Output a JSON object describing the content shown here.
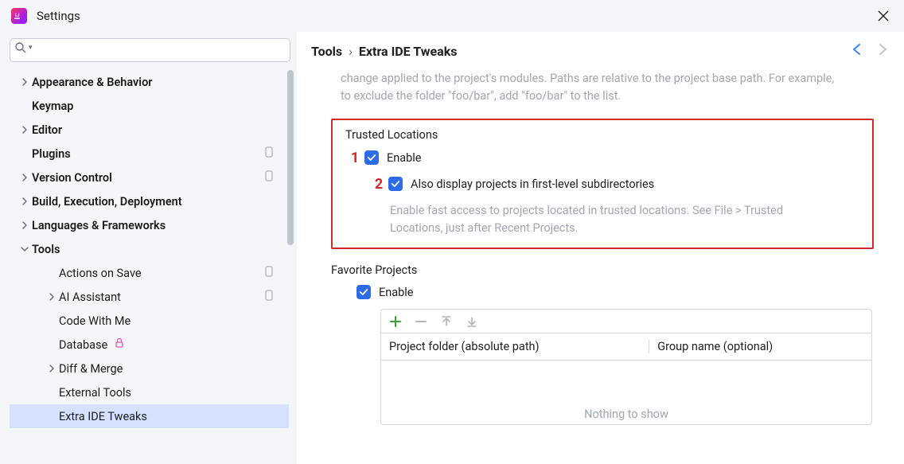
{
  "window": {
    "title": "Settings"
  },
  "breadcrumb": {
    "root": "Tools",
    "leaf": "Extra IDE Tweaks"
  },
  "nav": {
    "back_enabled": true,
    "forward_enabled": false
  },
  "search": {
    "value": ""
  },
  "sidebar": {
    "items": [
      {
        "label": "Appearance & Behavior",
        "level": 0,
        "chev": "right",
        "bold": true
      },
      {
        "label": "Keymap",
        "level": 0,
        "chev": "",
        "bold": true
      },
      {
        "label": "Editor",
        "level": 0,
        "chev": "right",
        "bold": true
      },
      {
        "label": "Plugins",
        "level": 0,
        "chev": "",
        "bold": true,
        "badge": "dot"
      },
      {
        "label": "Version Control",
        "level": 0,
        "chev": "right",
        "bold": true,
        "badge": "dot"
      },
      {
        "label": "Build, Execution, Deployment",
        "level": 0,
        "chev": "right",
        "bold": true
      },
      {
        "label": "Languages & Frameworks",
        "level": 0,
        "chev": "right",
        "bold": true
      },
      {
        "label": "Tools",
        "level": 0,
        "chev": "down",
        "bold": true
      },
      {
        "label": "Actions on Save",
        "level": 1,
        "chev": "",
        "bold": false,
        "badge": "dot"
      },
      {
        "label": "AI Assistant",
        "level": 1,
        "chev": "right",
        "bold": false,
        "badge": "dot"
      },
      {
        "label": "Code With Me",
        "level": 1,
        "chev": "",
        "bold": false
      },
      {
        "label": "Database",
        "level": 1,
        "chev": "",
        "bold": false,
        "lock": true
      },
      {
        "label": "Diff & Merge",
        "level": 1,
        "chev": "right",
        "bold": false
      },
      {
        "label": "External Tools",
        "level": 1,
        "chev": "",
        "bold": false
      },
      {
        "label": "Extra IDE Tweaks",
        "level": 1,
        "chev": "",
        "bold": false,
        "selected": true
      }
    ]
  },
  "main": {
    "desc_fragment": "change applied to the project's modules. Paths are relative to the project base path. For example, to exclude the folder \"foo/bar\", add \"foo/bar\" to the list.",
    "trusted": {
      "title": "Trusted Locations",
      "annotation1": "1",
      "annotation2": "2",
      "enable_label": "Enable",
      "sub_label": "Also display projects in first-level subdirectories",
      "hint": "Enable fast access to projects located in trusted locations. See File > Trusted Locations, just after Recent Projects."
    },
    "favorite": {
      "title": "Favorite Projects",
      "enable_label": "Enable",
      "col1": "Project folder (absolute path)",
      "col2": "Group name (optional)",
      "empty": "Nothing to show"
    }
  }
}
